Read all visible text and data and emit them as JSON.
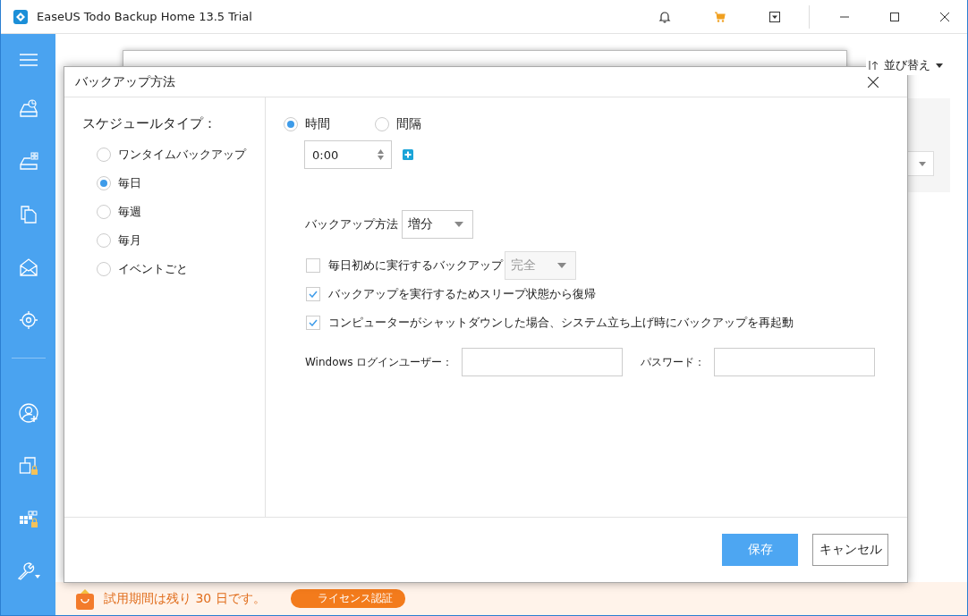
{
  "window": {
    "title": "EaseUS Todo Backup Home 13.5 Trial"
  },
  "sort": {
    "label": "並び替え"
  },
  "trial_banner": {
    "text": "試用期間は残り 30 日です。",
    "button": "ライセンス認証"
  },
  "dialog": {
    "title": "バックアップ方法",
    "schedule_label": "スケジュールタイプ：",
    "schedule_types": [
      {
        "label": "ワンタイムバックアップ",
        "selected": false
      },
      {
        "label": "毎日",
        "selected": true
      },
      {
        "label": "毎週",
        "selected": false
      },
      {
        "label": "毎月",
        "selected": false
      },
      {
        "label": "イベントごと",
        "selected": false
      }
    ],
    "time_modes": [
      {
        "label": "時間",
        "selected": true
      },
      {
        "label": "間隔",
        "selected": false
      }
    ],
    "time_value": "0:00",
    "backup_method": {
      "label": "バックアップ方法",
      "value": "増分"
    },
    "first_backup": {
      "label": "毎日初めに実行するバックアップ",
      "checked": false,
      "value": "完全",
      "disabled": true
    },
    "options": [
      {
        "label": "バックアップを実行するためスリープ状態から復帰",
        "checked": true
      },
      {
        "label": "コンピューターがシャットダウンした場合、システム立ち上げ時にバックアップを再起動",
        "checked": true
      }
    ],
    "login": {
      "user_label": "Windows ログインユーザー：",
      "password_label": "パスワード："
    },
    "buttons": [
      {
        "label": "保存",
        "kind": "primary"
      },
      {
        "label": "キャンセル",
        "kind": "secondary"
      }
    ]
  }
}
